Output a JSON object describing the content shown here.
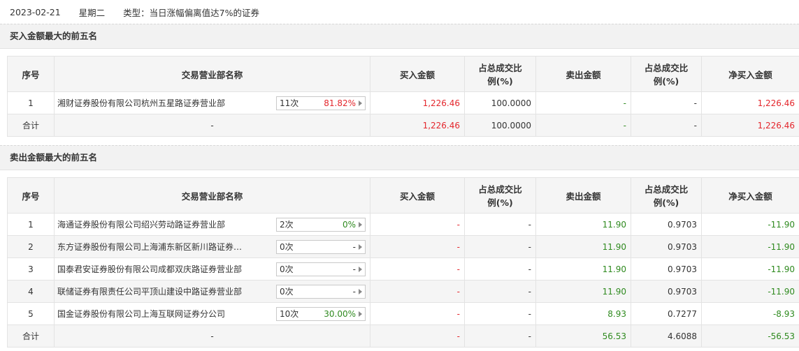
{
  "header": {
    "date": "2023-02-21",
    "weekday": "星期二",
    "type": "类型：当日涨幅偏离值达7%的证券"
  },
  "columns": [
    "序号",
    "交易营业部名称",
    "买入金额",
    "占总成交比例(%)",
    "卖出金额",
    "占总成交比例(%)",
    "净买入金额"
  ],
  "columns_split": {
    "ratio_line1": "占总成交比",
    "ratio_line2": "例(%)"
  },
  "buy_section": {
    "title": "买入金额最大的前五名",
    "rows": [
      {
        "idx": "1",
        "name": "湘财证券股份有限公司杭州五星路证券营业部",
        "count": "11次",
        "rate": "81.82%",
        "rate_color": "red",
        "buy": "1,226.46",
        "buy_ratio": "100.0000",
        "sell": "-",
        "sell_ratio": "-",
        "net": "1,226.46",
        "net_color": "red"
      }
    ],
    "total": {
      "label": "合计",
      "name": "-",
      "buy": "1,226.46",
      "buy_ratio": "100.0000",
      "sell": "-",
      "sell_ratio": "-",
      "net": "1,226.46"
    }
  },
  "sell_section": {
    "title": "卖出金额最大的前五名",
    "rows": [
      {
        "idx": "1",
        "name": "海通证券股份有限公司绍兴劳动路证券营业部",
        "count": "2次",
        "rate": "0%",
        "rate_color": "green",
        "buy": "-",
        "buy_ratio": "-",
        "sell": "11.90",
        "sell_ratio": "0.9703",
        "net": "-11.90"
      },
      {
        "idx": "2",
        "name": "东方证券股份有限公司上海浦东新区新川路证券…",
        "count": "0次",
        "rate": "-",
        "rate_color": "gray",
        "buy": "-",
        "buy_ratio": "-",
        "sell": "11.90",
        "sell_ratio": "0.9703",
        "net": "-11.90"
      },
      {
        "idx": "3",
        "name": "国泰君安证券股份有限公司成都双庆路证券营业部",
        "count": "0次",
        "rate": "-",
        "rate_color": "gray",
        "buy": "-",
        "buy_ratio": "-",
        "sell": "11.90",
        "sell_ratio": "0.9703",
        "net": "-11.90"
      },
      {
        "idx": "4",
        "name": "联储证券有限责任公司平顶山建设中路证券营业部",
        "count": "0次",
        "rate": "-",
        "rate_color": "gray",
        "buy": "-",
        "buy_ratio": "-",
        "sell": "11.90",
        "sell_ratio": "0.9703",
        "net": "-11.90"
      },
      {
        "idx": "5",
        "name": "国金证券股份有限公司上海互联网证券分公司",
        "count": "10次",
        "rate": "30.00%",
        "rate_color": "green",
        "buy": "-",
        "buy_ratio": "-",
        "sell": "8.93",
        "sell_ratio": "0.7277",
        "net": "-8.93"
      }
    ],
    "total": {
      "label": "合计",
      "name": "-",
      "buy": "-",
      "buy_ratio": "-",
      "sell": "56.53",
      "sell_ratio": "4.6088",
      "net": "-56.53"
    }
  },
  "colors": {
    "red": "#e4262c",
    "green": "#2f8a1f",
    "header_bg": "#f5f5f5",
    "border": "#e3e3e3"
  }
}
